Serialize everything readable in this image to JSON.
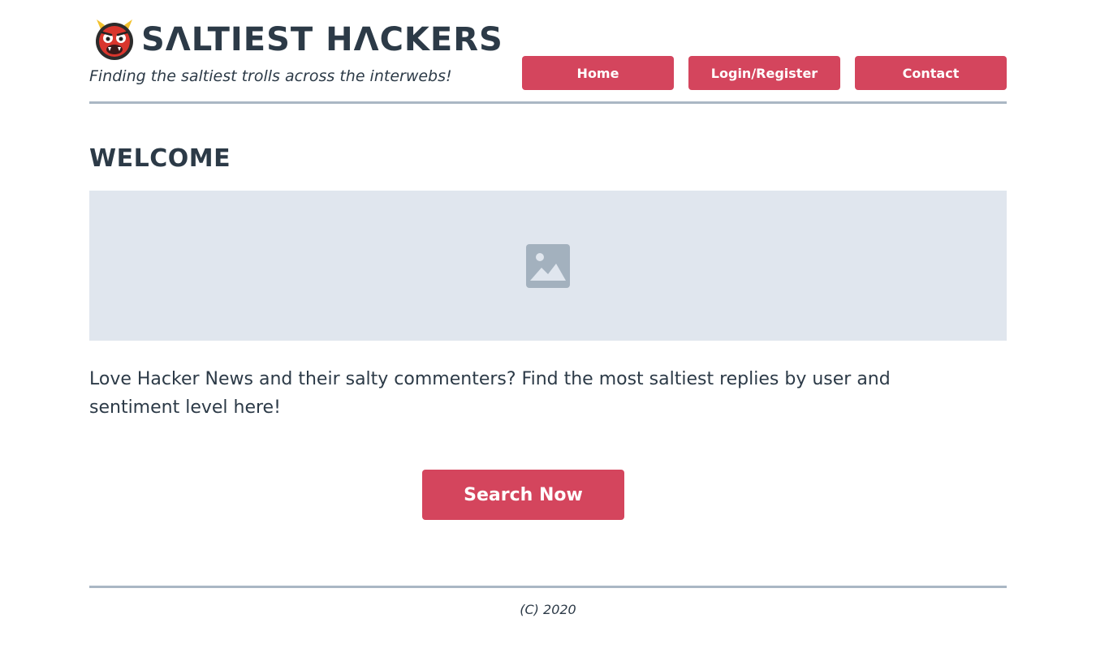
{
  "header": {
    "title": "SΛLTIEST HΛCKERS",
    "tagline": "Finding the saltiest trolls across the interwebs!",
    "logo_icon": "oni-mask-icon"
  },
  "nav": {
    "items": [
      {
        "label": "Home"
      },
      {
        "label": "Login/Register"
      },
      {
        "label": "Contact"
      }
    ]
  },
  "main": {
    "heading": "WELCOME",
    "hero_image_icon": "image-placeholder-icon",
    "intro": "Love Hacker News and their salty commenters? Find the most saltiest replies by user and sentiment level here!",
    "cta_label": "Search Now"
  },
  "footer": {
    "copyright": "(C) 2020"
  },
  "colors": {
    "accent": "#d4455d",
    "text": "#2c3a47",
    "rule": "#aab7c4",
    "image_bg": "#e0e6ee"
  }
}
